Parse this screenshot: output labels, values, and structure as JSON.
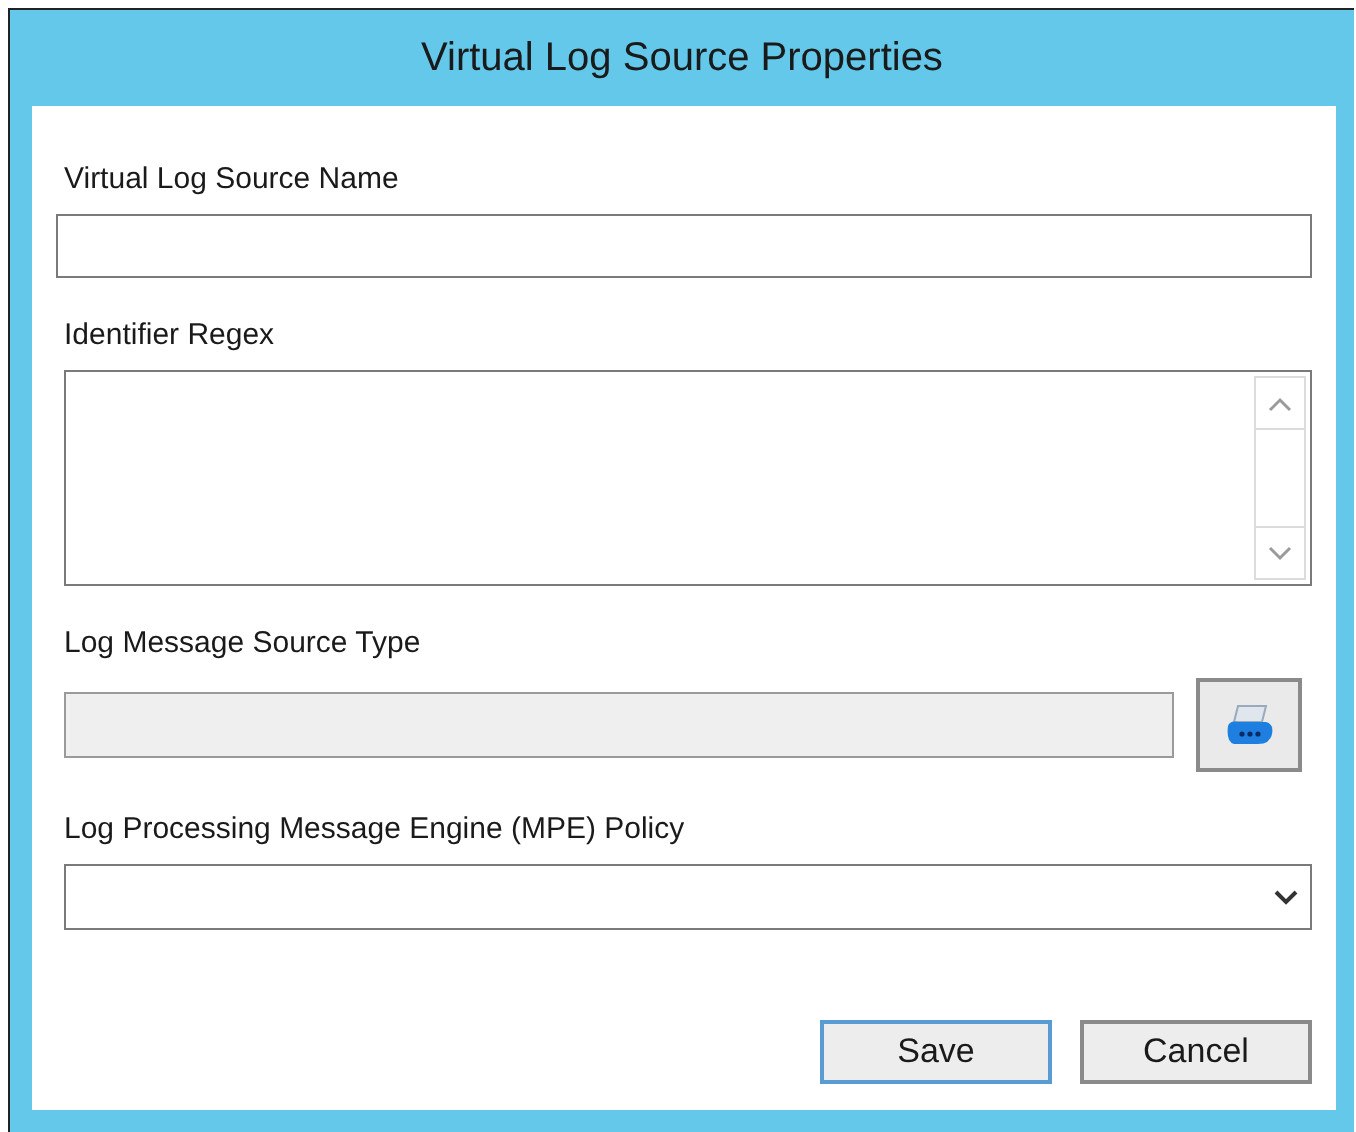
{
  "window": {
    "title": "Virtual Log Source Properties"
  },
  "fields": [
    {
      "kind": "text",
      "label": "Virtual Log Source Name"
    },
    {
      "kind": "textarea",
      "label": "Identifier Regex"
    },
    {
      "kind": "browse",
      "label": "Log Message Source Type",
      "disabled": true
    },
    {
      "kind": "select",
      "label": "Log Processing Message Engine (MPE) Policy"
    }
  ],
  "buttons": [
    {
      "label": "Save",
      "focused": true
    },
    {
      "label": "Cancel",
      "focused": false
    }
  ]
}
